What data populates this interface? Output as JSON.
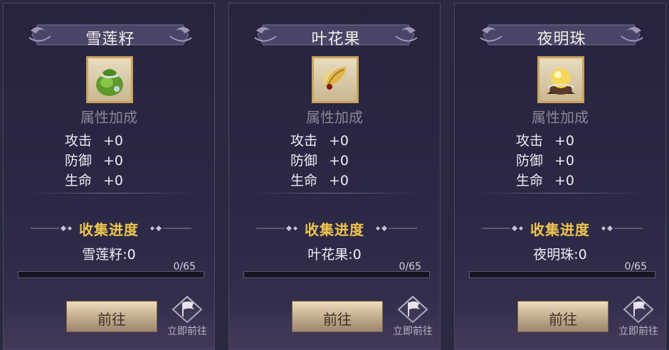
{
  "cards": [
    {
      "title": "雪莲籽",
      "item_icon": "green-pouch-icon",
      "attr_header": "属性加成",
      "stats": [
        {
          "label": "攻击",
          "value": "+0"
        },
        {
          "label": "防御",
          "value": "+0"
        },
        {
          "label": "生命",
          "value": "+0"
        }
      ],
      "collect_title": "收集进度",
      "count_text": "雪莲籽:0",
      "progress_text": "0/65",
      "progress": 0,
      "go_label": "前往",
      "instant_label": "立即前往"
    },
    {
      "title": "叶花果",
      "item_icon": "golden-leaf-fruit-icon",
      "attr_header": "属性加成",
      "stats": [
        {
          "label": "攻击",
          "value": "+0"
        },
        {
          "label": "防御",
          "value": "+0"
        },
        {
          "label": "生命",
          "value": "+0"
        }
      ],
      "collect_title": "收集进度",
      "count_text": "叶花果:0",
      "progress_text": "0/65",
      "progress": 0,
      "go_label": "前往",
      "instant_label": "立即前往"
    },
    {
      "title": "夜明珠",
      "item_icon": "glowing-pearl-icon",
      "attr_header": "属性加成",
      "stats": [
        {
          "label": "攻击",
          "value": "+0"
        },
        {
          "label": "防御",
          "value": "+0"
        },
        {
          "label": "生命",
          "value": "+0"
        }
      ],
      "collect_title": "收集进度",
      "count_text": "夜明珠:0",
      "progress_text": "0/65",
      "progress": 0,
      "go_label": "前往",
      "instant_label": "立即前往"
    }
  ],
  "colors": {
    "gold_title": "#f0c44e",
    "button_bg": "#dec69a",
    "panel_bg": "#2a2844"
  }
}
